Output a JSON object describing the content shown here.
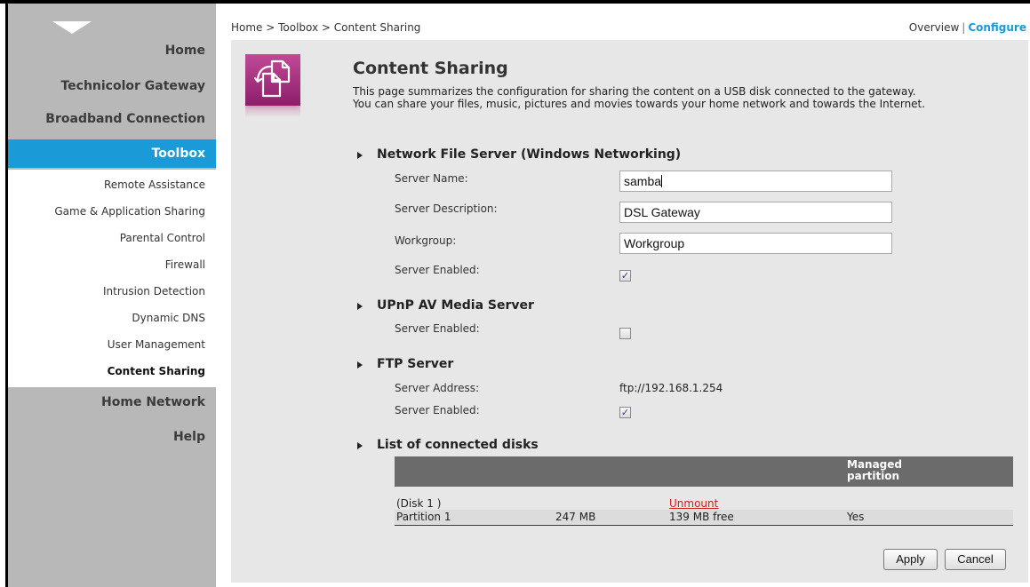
{
  "sidebar": {
    "main_items": [
      "Home",
      "Technicolor Gateway",
      "Broadband Connection"
    ],
    "selected": "Toolbox",
    "sub_items": [
      "Remote Assistance",
      "Game & Application Sharing",
      "Parental Control",
      "Firewall",
      "Intrusion Detection",
      "Dynamic DNS",
      "User Management",
      "Content Sharing"
    ],
    "active_sub": "Content Sharing",
    "bottom_items": [
      "Home Network",
      "Help"
    ]
  },
  "breadcrumb": "Home > Toolbox > Content Sharing",
  "topnav": {
    "overview": "Overview",
    "separator": "|",
    "configure": "Configure"
  },
  "page": {
    "title": "Content Sharing",
    "desc_line1": "This page summarizes the configuration for sharing the content on a USB disk connected to the gateway.",
    "desc_line2": "You can share your files, music, pictures and movies towards your home network and towards the Internet."
  },
  "nfs": {
    "heading": "Network File Server (Windows Networking)",
    "server_name_label": "Server Name:",
    "server_name_value": "samba",
    "server_desc_label": "Server Description:",
    "server_desc_value": "DSL Gateway",
    "workgroup_label": "Workgroup:",
    "workgroup_value": "Workgroup",
    "enabled_label": "Server Enabled:",
    "enabled": true
  },
  "upnp": {
    "heading": "UPnP AV Media Server",
    "enabled_label": "Server Enabled:",
    "enabled": false
  },
  "ftp": {
    "heading": "FTP Server",
    "address_label": "Server Address:",
    "address_value": "ftp://192.168.1.254",
    "enabled_label": "Server Enabled:",
    "enabled": true
  },
  "disks": {
    "heading": "List of connected disks",
    "columns": [
      "",
      "",
      "",
      "Managed partition"
    ],
    "col4_line1": "Managed",
    "col4_line2": "partition",
    "disk_name": "(Disk 1 )",
    "disk_action": "Unmount",
    "partition": {
      "name": "Partition 1",
      "size": "247 MB",
      "free": "139 MB free",
      "managed": "Yes"
    }
  },
  "buttons": {
    "apply": "Apply",
    "cancel": "Cancel"
  }
}
